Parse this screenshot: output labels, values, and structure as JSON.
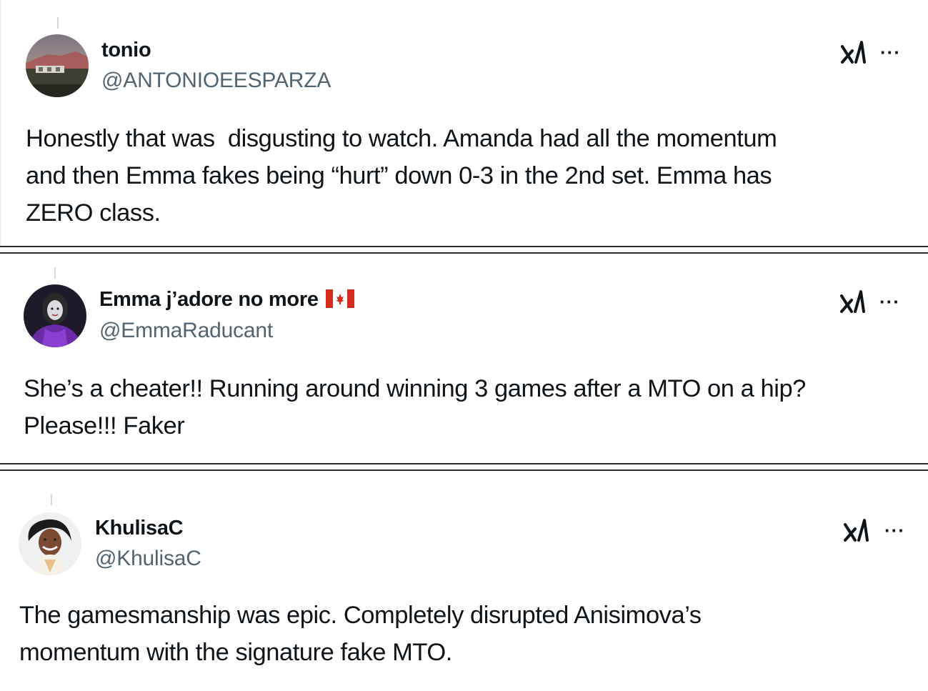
{
  "tweets": [
    {
      "display_name": "tonio",
      "handle": "@ANTONIOEESPARZA",
      "text": "Honestly that was  disgusting to watch. Amanda had all the momentum\nand then Emma fakes being “hurt” down 0-3 in the 2nd set. Emma has\nZERO class.",
      "grok_icon": "grok-icon",
      "more_icon": "more-options-icon",
      "more_glyph": "···"
    },
    {
      "display_name": "Emma j’adore no more",
      "flag": "canada-flag-icon",
      "handle": "@EmmaRaducant",
      "text": "She’s a cheater!! Running around winning 3 games after a MTO on a hip?\nPlease!!! Faker",
      "grok_icon": "grok-icon",
      "more_icon": "more-options-icon",
      "more_glyph": "···"
    },
    {
      "display_name": "KhulisaC",
      "handle": "@KhulisaC",
      "text": "The gamesmanship was epic. Completely disrupted Anisimova’s\nmomentum with the signature fake MTO.",
      "grok_icon": "grok-icon",
      "more_icon": "more-options-icon",
      "more_glyph": "···"
    }
  ],
  "colors": {
    "text_primary": "#0f1419",
    "text_secondary": "#536471",
    "separator": "#2b2b2b",
    "flag_red": "#d52b1e"
  }
}
